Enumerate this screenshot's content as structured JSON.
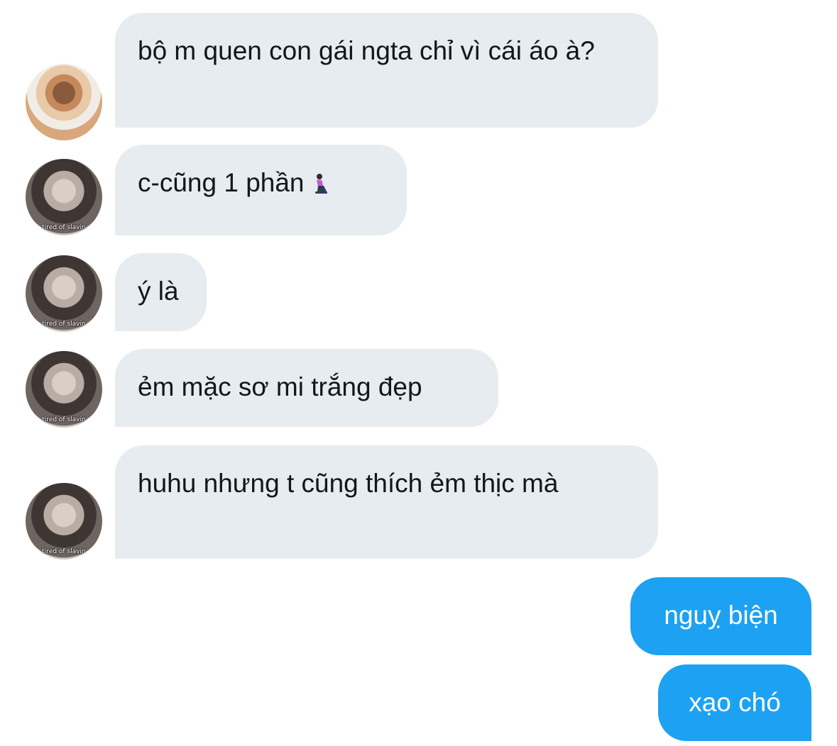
{
  "conversation": {
    "messages": [
      {
        "sender": "them",
        "avatar": "avatar-a",
        "text": "bộ m quen con gái ngta chỉ vì cái áo à?"
      },
      {
        "sender": "me",
        "avatar": "avatar-b",
        "avatar_caption": "tired of slavin",
        "text": "c-cũng 1 phần",
        "emoji": "kneeling-person-emoji"
      },
      {
        "sender": "me",
        "avatar": "avatar-b",
        "avatar_caption": "tired of slavin",
        "text": "ý là"
      },
      {
        "sender": "me",
        "avatar": "avatar-b",
        "avatar_caption": "tired of slavin",
        "text": "ẻm mặc sơ mi trắng đẹp"
      },
      {
        "sender": "me",
        "avatar": "avatar-b",
        "avatar_caption": "tired of slavin",
        "text": "huhu nhưng t cũng thích ẻm thịc mà"
      },
      {
        "sender": "self",
        "text": "nguỵ biện"
      },
      {
        "sender": "self",
        "text": "xạo chó"
      }
    ]
  },
  "colors": {
    "incoming_bubble": "#e6ecf0",
    "outgoing_bubble": "#1da1f2",
    "incoming_text": "#14171a",
    "outgoing_text": "#ffffff"
  }
}
